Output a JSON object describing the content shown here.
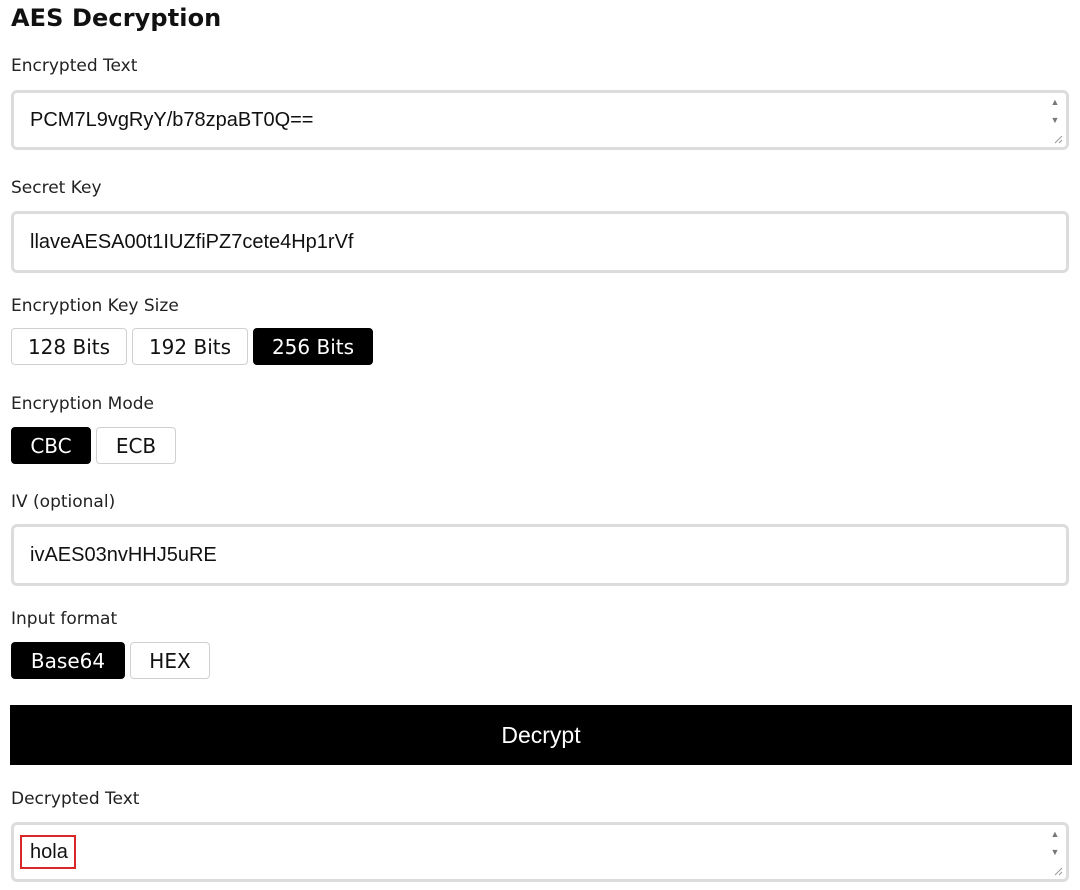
{
  "title": "AES Decryption",
  "encrypted_text": {
    "label": "Encrypted Text",
    "value": "PCM7L9vgRyY/b78zpaBT0Q=="
  },
  "secret_key": {
    "label": "Secret Key",
    "value": "llaveAESA00t1IUZfiPZ7cete4Hp1rVf"
  },
  "key_size": {
    "label": "Encryption Key Size",
    "options": [
      "128 Bits",
      "192 Bits",
      "256 Bits"
    ],
    "selected": "256 Bits"
  },
  "mode": {
    "label": "Encryption Mode",
    "options": [
      "CBC",
      "ECB"
    ],
    "selected": "CBC"
  },
  "iv": {
    "label": "IV (optional)",
    "value": "ivAES03nvHHJ5uRE"
  },
  "input_format": {
    "label": "Input format",
    "options": [
      "Base64",
      "HEX"
    ],
    "selected": "Base64"
  },
  "decrypt_button": "Decrypt",
  "decrypted_text": {
    "label": "Decrypted Text",
    "value": "hola",
    "highlight_color": "#d9262a"
  },
  "icons": [
    "spin-up-icon",
    "spin-down-icon",
    "resize-grip-icon"
  ]
}
